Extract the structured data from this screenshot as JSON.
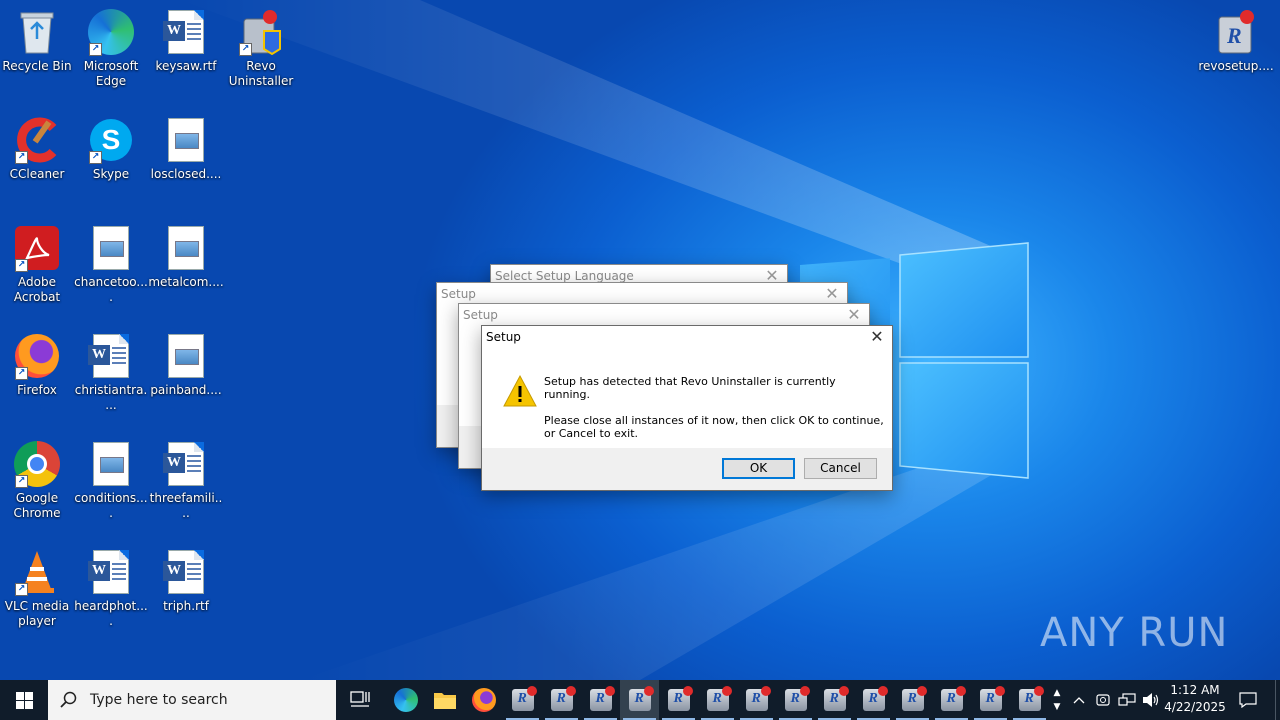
{
  "desktop": {
    "icons": [
      {
        "label": "Recycle Bin"
      },
      {
        "label": "Microsoft Edge"
      },
      {
        "label": "keysaw.rtf"
      },
      {
        "label": "Revo Uninstaller"
      },
      {
        "label": "CCleaner"
      },
      {
        "label": "Skype"
      },
      {
        "label": "losclosed...."
      },
      {
        "label": "Adobe Acrobat"
      },
      {
        "label": "chancetoo...."
      },
      {
        "label": "metalcom...."
      },
      {
        "label": "Firefox"
      },
      {
        "label": "christiantra...."
      },
      {
        "label": "painband...."
      },
      {
        "label": "Google Chrome"
      },
      {
        "label": "conditions...."
      },
      {
        "label": "threefamili...."
      },
      {
        "label": "VLC media player"
      },
      {
        "label": "heardphot...."
      },
      {
        "label": "triph.rtf"
      },
      {
        "label": "revosetup...."
      }
    ]
  },
  "dialogs": {
    "lang": {
      "title": "Select Setup Language"
    },
    "setup1": {
      "title": "Setup"
    },
    "setup2": {
      "title": "Setup"
    },
    "main": {
      "title": "Setup",
      "message1": "Setup has detected that Revo Uninstaller is currently running.",
      "message2": "Please close all instances of it now, then click OK to continue,",
      "message3": "or Cancel to exit.",
      "ok_label": "OK",
      "cancel_label": "Cancel"
    }
  },
  "taskbar": {
    "search_placeholder": "Type here to search",
    "clock_time": "1:12 AM",
    "clock_date": "4/22/2025"
  },
  "watermark": "ANY RUN",
  "colors": {
    "accent": "#0078d7",
    "taskbar": "#101c2a",
    "warning": "#f5c400"
  }
}
